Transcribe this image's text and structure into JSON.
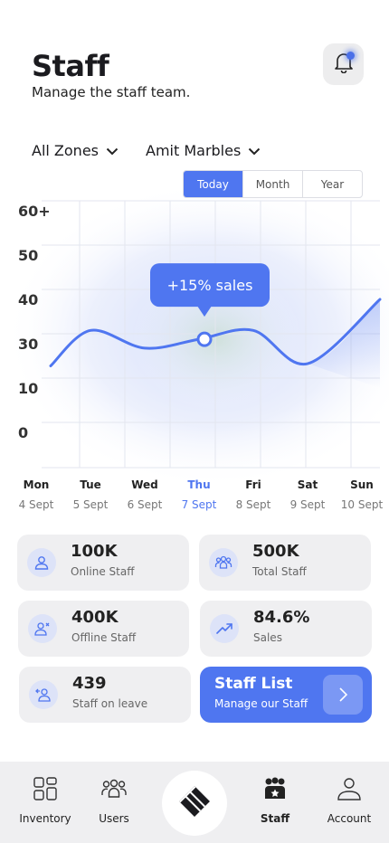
{
  "header": {
    "title": "Staff",
    "subtitle": "Manage the staff team."
  },
  "filters": {
    "zone": "All Zones",
    "company": "Amit Marbles"
  },
  "period_tabs": [
    "Today",
    "Month",
    "Year"
  ],
  "active_period": "Today",
  "chart_data": {
    "type": "line",
    "y_tick_labels": [
      "60+",
      "50",
      "40",
      "30",
      "10",
      "0"
    ],
    "categories": [
      "Mon",
      "Tue",
      "Wed",
      "Thu",
      "Fri",
      "Sat",
      "Sun"
    ],
    "dates": [
      "4 Sept",
      "5 Sept",
      "6 Sept",
      "7 Sept",
      "8 Sept",
      "9 Sept",
      "10 Sept"
    ],
    "values": [
      20,
      33,
      28,
      31,
      33,
      21,
      40
    ],
    "highlight_index": 3,
    "tooltip": "+15% sales",
    "grid": true,
    "accent": "#4f76f0"
  },
  "stats": [
    {
      "value": "100K",
      "label": "Online Staff",
      "icon": "user-icon"
    },
    {
      "value": "500K",
      "label": "Total Staff",
      "icon": "users-group-icon"
    },
    {
      "value": "400K",
      "label": "Offline Staff",
      "icon": "user-offline-icon"
    },
    {
      "value": "84.6%",
      "label": "Sales",
      "icon": "trend-up-icon"
    },
    {
      "value": "439",
      "label": "Staff on leave",
      "icon": "user-leave-icon"
    }
  ],
  "cta": {
    "title": "Staff List",
    "subtitle": "Manage our Staff"
  },
  "nav": {
    "items": [
      "Inventory",
      "Users",
      "Staff",
      "Account"
    ],
    "active": "Staff"
  },
  "colors": {
    "accent": "#4f76f0",
    "card_bg": "#efeff1",
    "icon_bg": "#dde3f8"
  }
}
